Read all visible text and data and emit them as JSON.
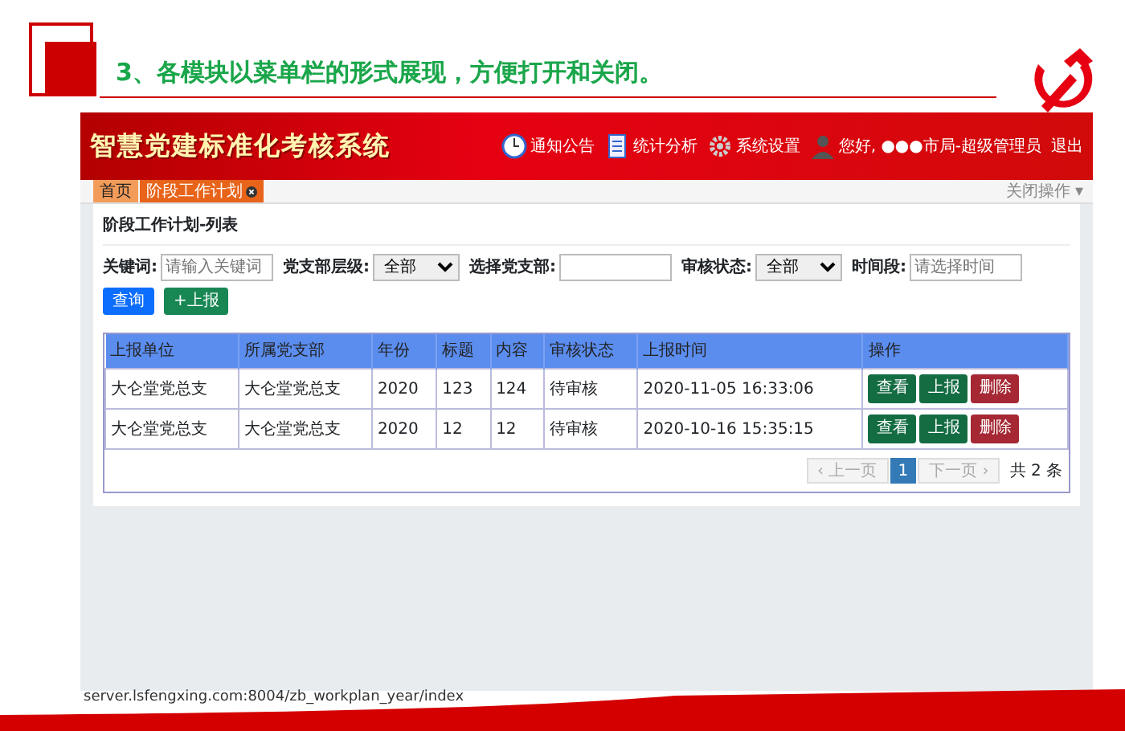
{
  "slide": {
    "title": "3、各模块以菜单栏的形式展现，方便打开和关闭。"
  },
  "banner": {
    "title": "智慧党建标准化考核系统",
    "items": [
      {
        "kind": "clock",
        "label": "通知公告"
      },
      {
        "kind": "document",
        "label": "统计分析"
      },
      {
        "kind": "gear",
        "label": "系统设置"
      },
      {
        "kind": "user",
        "label": "您好, ●●●市局-超级管理员"
      },
      {
        "kind": "logout",
        "label": "退出"
      }
    ]
  },
  "tabs": [
    {
      "label": "首页",
      "selected": false,
      "closable": false
    },
    {
      "label": "阶段工作计划",
      "selected": true,
      "closable": true
    }
  ],
  "close_menu": "关闭操作 ▾",
  "panel_title": "阶段工作计划-列表",
  "filters": [
    {
      "kind": "input",
      "label": "关键词:",
      "placeholder": "请输入关键词"
    },
    {
      "kind": "select",
      "label": "党支部层级:",
      "value": "全部"
    },
    {
      "kind": "input",
      "label": "选择党支部:"
    },
    {
      "kind": "select",
      "label": "审核状态:",
      "value": "全部"
    },
    {
      "kind": "input",
      "label": "时间段:",
      "placeholder": "请选择时间"
    }
  ],
  "filter_buttons": [
    {
      "kind": "primary",
      "label": "查询"
    },
    {
      "kind": "success",
      "label": "+上报"
    }
  ],
  "table": {
    "columns": [
      "上报单位",
      "所属党支部",
      "年份",
      "标题",
      "内容",
      "审核状态",
      "上报时间",
      "操作"
    ],
    "rows": [
      {
        "cells": [
          "大仑堂党总支",
          "大仑堂党总支",
          "2020",
          "123",
          "124",
          "待审核",
          "2020-11-05 16:33:06"
        ],
        "actions": [
          {
            "kind": "success",
            "label": "查看"
          },
          {
            "kind": "success",
            "label": "上报"
          },
          {
            "kind": "danger",
            "label": "删除"
          }
        ]
      },
      {
        "cells": [
          "大仑堂党总支",
          "大仑堂党总支",
          "2020",
          "12",
          "12",
          "待审核",
          "2020-10-16 15:35:15"
        ],
        "actions": [
          {
            "kind": "success",
            "label": "查看"
          },
          {
            "kind": "success",
            "label": "上报"
          },
          {
            "kind": "danger",
            "label": "删除"
          }
        ]
      }
    ]
  },
  "pagination": {
    "pages": [
      {
        "kind": "prev",
        "label": "‹ 上一页",
        "disabled": true,
        "selected": false
      },
      {
        "kind": "page",
        "label": "1",
        "disabled": false,
        "selected": true
      },
      {
        "kind": "next",
        "label": "下一页 ›",
        "disabled": true,
        "selected": false
      }
    ],
    "total": "共 2 条"
  },
  "status_url": "server.lsfengxing.com:8004/zb_workplan_year/index"
}
